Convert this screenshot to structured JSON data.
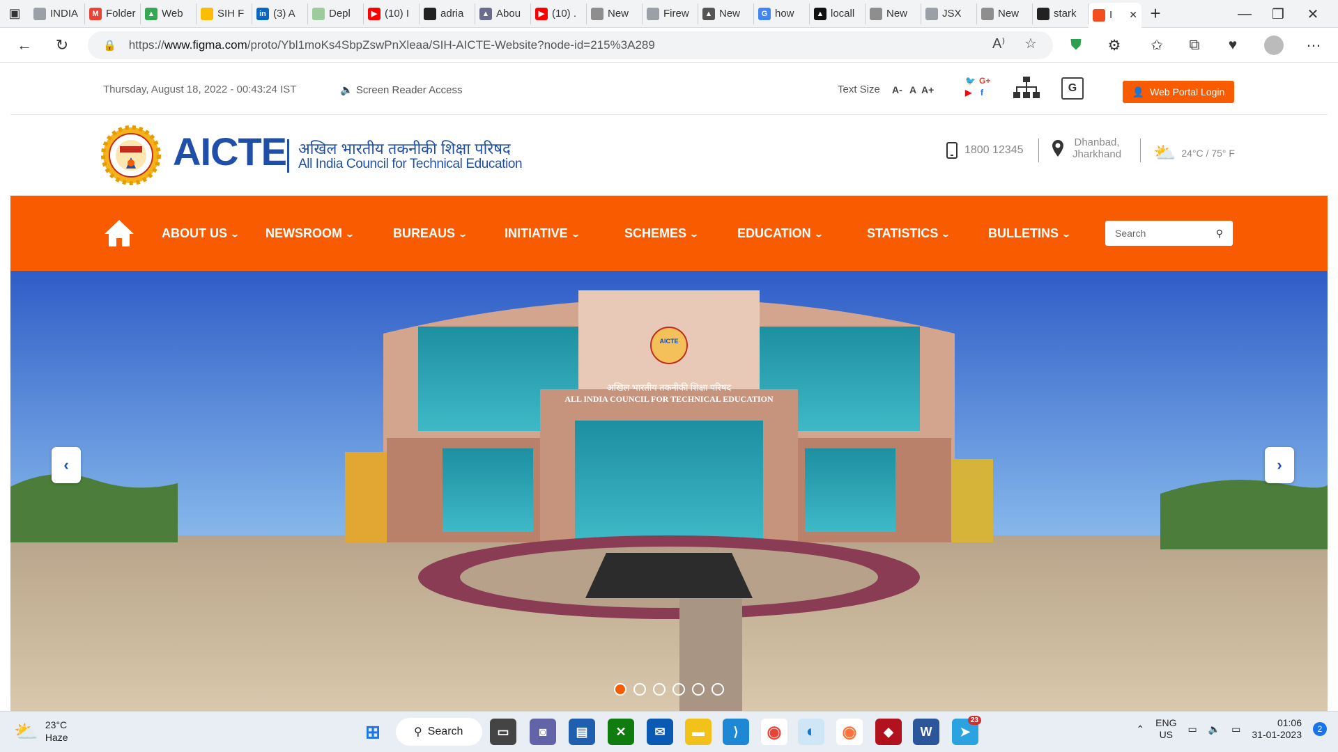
{
  "browser": {
    "tabs": [
      {
        "label": "INDIA",
        "fav": "#9aa0a6",
        "glyph": ""
      },
      {
        "label": "Folder",
        "fav": "#ea4335",
        "glyph": "M"
      },
      {
        "label": "Web",
        "fav": "#34a853",
        "glyph": "▲"
      },
      {
        "label": "SIH F",
        "fav": "#fbbc04",
        "glyph": ""
      },
      {
        "label": "(3) A",
        "fav": "#0a66c2",
        "glyph": "in"
      },
      {
        "label": "Depl",
        "fav": "#9ccc9c",
        "glyph": ""
      },
      {
        "label": "(10) I",
        "fav": "#ff0000",
        "glyph": "▶"
      },
      {
        "label": "adria",
        "fav": "#222",
        "glyph": ""
      },
      {
        "label": "Abou",
        "fav": "#6b6b8e",
        "glyph": "▲"
      },
      {
        "label": "(10) .",
        "fav": "#ff0000",
        "glyph": "▶"
      },
      {
        "label": "New",
        "fav": "#8e8e8e",
        "glyph": ""
      },
      {
        "label": "Firew",
        "fav": "#9aa0a6",
        "glyph": ""
      },
      {
        "label": "New",
        "fav": "#555",
        "glyph": "▲"
      },
      {
        "label": "how",
        "fav": "#4285f4",
        "glyph": "G"
      },
      {
        "label": "locall",
        "fav": "#111",
        "glyph": "▲"
      },
      {
        "label": "New",
        "fav": "#8e8e8e",
        "glyph": ""
      },
      {
        "label": "JSX",
        "fav": "#9aa0a6",
        "glyph": ""
      },
      {
        "label": "New",
        "fav": "#8e8e8e",
        "glyph": ""
      },
      {
        "label": "stark",
        "fav": "#222",
        "glyph": ""
      }
    ],
    "active_tab": {
      "label": "I",
      "fav": "#f24e1e"
    },
    "url_prefix": "https://",
    "url_host": "www.figma.com",
    "url_path": "/proto/Ybl1moKs4SbpZswPnXleaa/SIH-AICTE-Website?node-id=215%3A289"
  },
  "site": {
    "datetime": "Thursday, August 18, 2022 - 00:43:24 IST",
    "screen_reader": "Screen Reader Access",
    "text_size_label": "Text Size",
    "text_size_buttons": [
      "A-",
      "A",
      "A+"
    ],
    "portal_login": "Web Portal Login",
    "brand": "AICTE",
    "brand_hindi": "अखिल भारतीय तकनीकी शिक्षा परिषद",
    "brand_english": "All India Council for Technical Education",
    "phone": "1800 12345",
    "location_line1": "Dhanbad,",
    "location_line2": "Jharkhand",
    "weather": "24°C / 75° F",
    "nav": [
      "ABOUT US",
      "NEWSROOM",
      "BUREAUS",
      "INITIATIVE",
      "SCHEMES",
      "EDUCATION",
      "STATISTICS",
      "BULLETINS"
    ],
    "search_placeholder": "Search",
    "hero_sign_hindi": "अखिल भारतीय तकनीकी शिक्षा परिषद",
    "hero_sign_english": "ALL INDIA COUNCIL FOR TECHNICAL EDUCATION",
    "hero_emblem": "AICTE",
    "slides_total": 6,
    "slide_active": 1
  },
  "taskbar": {
    "temp": "23°C",
    "condition": "Haze",
    "search_label": "Search",
    "lang1": "ENG",
    "lang2": "US",
    "time": "01:06",
    "date": "31-01-2023",
    "notifications": "2",
    "telegram_badge": "23"
  },
  "colors": {
    "accent": "#f85b00",
    "brand": "#1f4fa8"
  }
}
